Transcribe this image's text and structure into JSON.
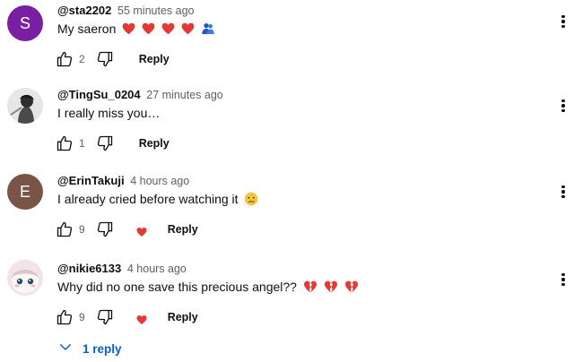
{
  "comments": [
    {
      "author": "@sta2202",
      "time": "55 minutes ago",
      "text": "My saeron",
      "avatar_letter": "S",
      "avatar_color": "#7b1fa2",
      "likes": "2",
      "reply_label": "Reply",
      "emojis": [
        "red-heart",
        "red-heart",
        "red-heart",
        "red-heart",
        "people-hugging"
      ]
    },
    {
      "author": "@TingSu_0204",
      "time": "27 minutes ago",
      "text": "I really miss you…",
      "avatar_letter": "",
      "likes": "1",
      "reply_label": "Reply",
      "emojis": []
    },
    {
      "author": "@ErinTakuji",
      "time": "4 hours ago",
      "text": "I already cried before watching it",
      "avatar_letter": "E",
      "avatar_color": "#795548",
      "likes": "9",
      "reply_label": "Reply",
      "emojis": [
        "crying-face"
      ],
      "creator_heart": true
    },
    {
      "author": "@nikie6133",
      "time": "4 hours ago",
      "text": "Why did no one save this precious angel??",
      "avatar_letter": "",
      "likes": "9",
      "reply_label": "Reply",
      "emojis": [
        "broken-heart",
        "broken-heart",
        "broken-heart"
      ],
      "creator_heart": true
    }
  ],
  "replies_toggle": "1 reply",
  "colors": {
    "link": "#065fd4",
    "heart": "#e53935",
    "secondary_text": "#606060"
  }
}
